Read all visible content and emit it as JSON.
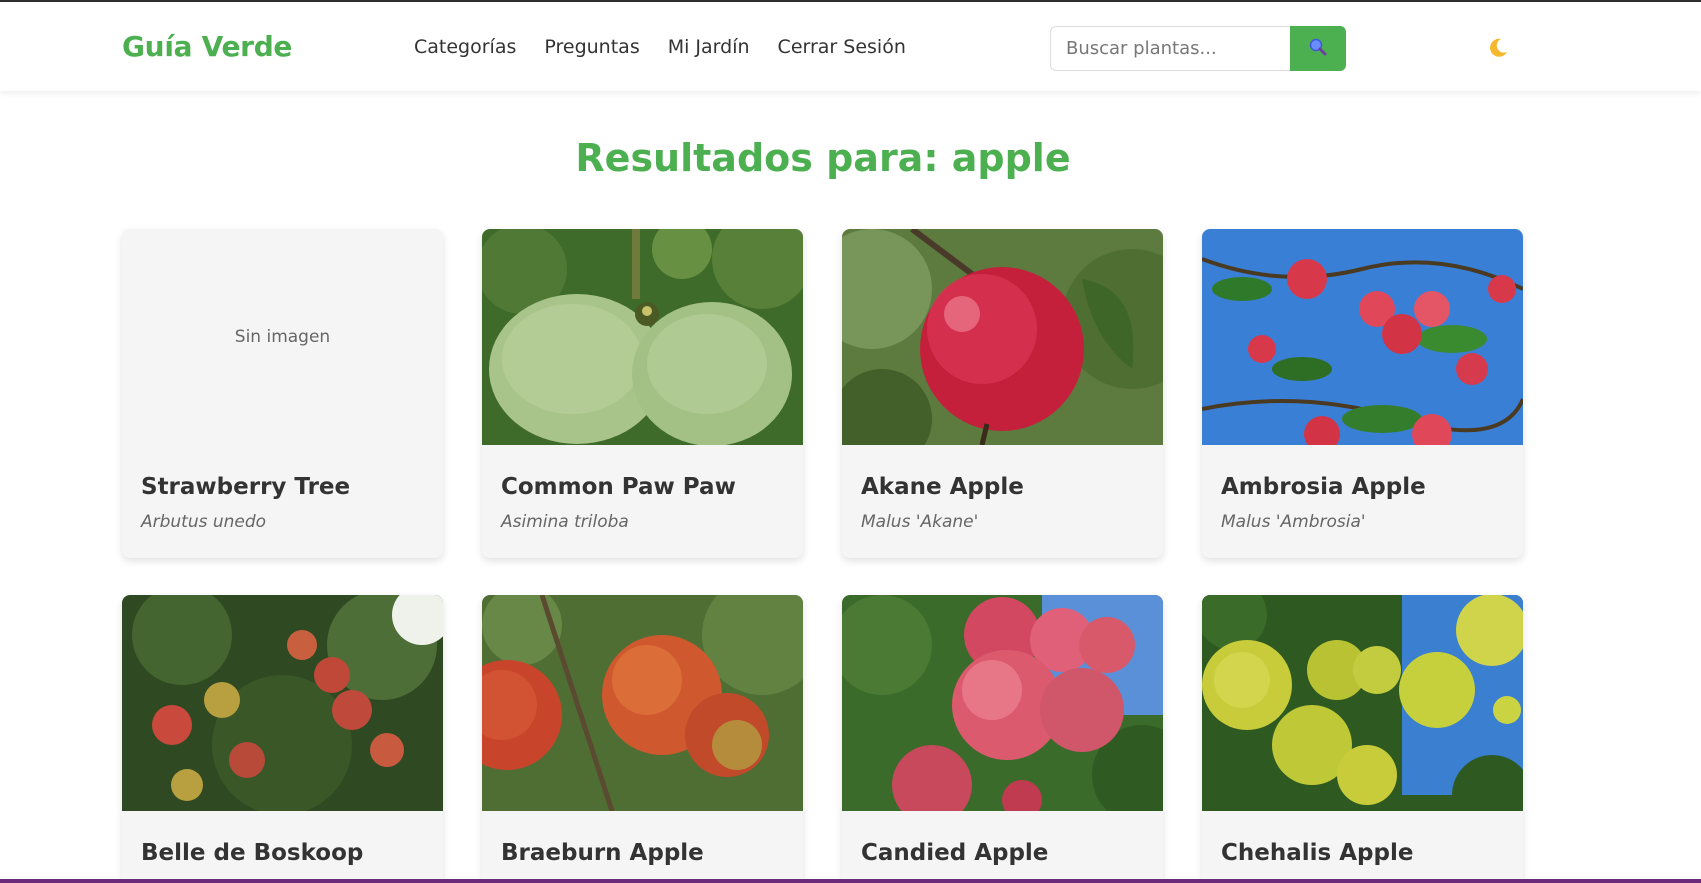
{
  "nav": {
    "brand": "Guía Verde",
    "links": [
      "Categorías",
      "Preguntas",
      "Mi Jardín",
      "Cerrar Sesión"
    ],
    "search_placeholder": "Buscar plantas...",
    "search_icon": "search-icon",
    "theme_icon": "moon-icon"
  },
  "page": {
    "title": "Resultados para: apple"
  },
  "cards": [
    {
      "name": "Strawberry Tree",
      "scientific": "Arbutus unedo",
      "image": "none",
      "no_image_text": "Sin imagen"
    },
    {
      "name": "Common Paw Paw",
      "scientific": "Asimina triloba",
      "image": "pawpaw-photo"
    },
    {
      "name": "Akane Apple",
      "scientific": "Malus 'Akane'",
      "image": "red-apple-photo"
    },
    {
      "name": "Ambrosia Apple",
      "scientific": "Malus 'Ambrosia'",
      "image": "apple-tree-sky-photo"
    },
    {
      "name": "Belle de Boskoop Apple",
      "scientific": "",
      "image": "apple-tree-photo"
    },
    {
      "name": "Braeburn Apple",
      "scientific": "",
      "image": "braeburn-photo"
    },
    {
      "name": "Candied Apple Flowering Crab",
      "scientific": "",
      "image": "candied-apple-photo"
    },
    {
      "name": "Chehalis Apple",
      "scientific": "",
      "image": "green-apple-photo"
    }
  ],
  "colors": {
    "brand_green": "#4caf50",
    "card_bg": "#f5f5f5",
    "text_dark": "#333333",
    "text_muted": "#666666",
    "bottom_bar": "#6b2a7a"
  }
}
